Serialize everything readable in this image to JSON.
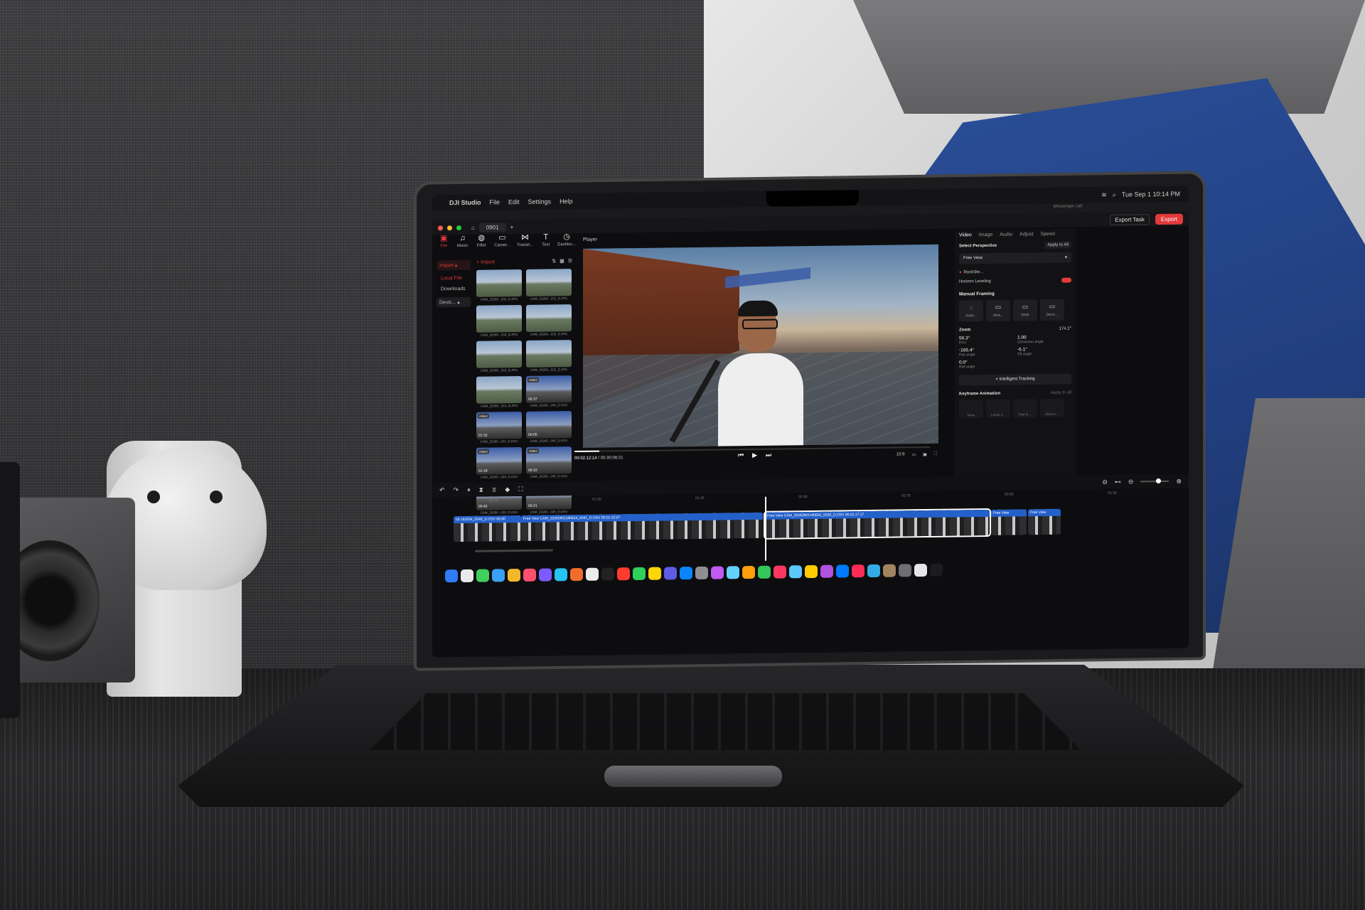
{
  "menubar": {
    "app_name": "DJI Studio",
    "menus": [
      "File",
      "Edit",
      "Settings",
      "Help"
    ],
    "clock": "Tue Sep 1 10:14 PM",
    "messenger": "Messenger call"
  },
  "titlebar": {
    "project_tab": "0901",
    "export_task": "Export Task",
    "export": "Export"
  },
  "left_tools": [
    {
      "icon": "file-icon",
      "glyph": "▣",
      "label": "File",
      "active": true
    },
    {
      "icon": "music-icon",
      "glyph": "♫",
      "label": "Music",
      "active": false
    },
    {
      "icon": "filter-icon",
      "glyph": "◍",
      "label": "Filter",
      "active": false
    },
    {
      "icon": "camera-icon",
      "glyph": "▭",
      "label": "Camer...",
      "active": false
    },
    {
      "icon": "transition-icon",
      "glyph": "⋈",
      "label": "Transit...",
      "active": false
    },
    {
      "icon": "text-icon",
      "glyph": "T",
      "label": "Text",
      "active": false
    },
    {
      "icon": "dashboard-icon",
      "glyph": "◷",
      "label": "Dashbo...",
      "active": false
    }
  ],
  "sidebar": {
    "import_label": "Import",
    "items": [
      "Local File",
      "Downloads"
    ],
    "device_label": "Devic..."
  },
  "media": {
    "import_button": "+ Import",
    "thumbs": [
      {
        "caption": "CAM_20260...032_D.JPG",
        "added": "",
        "duration": "",
        "video": false
      },
      {
        "caption": "CAM_20260...031_D.JPG",
        "added": "",
        "duration": "",
        "video": false
      },
      {
        "caption": "CAM_20260...034_D.JPG",
        "added": "",
        "duration": "",
        "video": false
      },
      {
        "caption": "CAM_20260...033_D.JPG",
        "added": "",
        "duration": "",
        "video": false
      },
      {
        "caption": "CAM_20260...022_D.JPG",
        "added": "",
        "duration": "",
        "video": false
      },
      {
        "caption": "CAM_20260...021_D.JPG",
        "added": "",
        "duration": "",
        "video": false
      },
      {
        "caption": "CAM_20260...014_D.JPG",
        "added": "",
        "duration": "",
        "video": false
      },
      {
        "caption": "CAM_20260...046_D.OSV",
        "added": "Added",
        "duration": "00:37",
        "video": true
      },
      {
        "caption": "CAM_20260...041_D.OSV",
        "added": "Added",
        "duration": "01:32",
        "video": true
      },
      {
        "caption": "CAM_20260...040_D.OSV",
        "added": "",
        "duration": "00:05",
        "video": true
      },
      {
        "caption": "CAM_20260...039_D.OSV",
        "added": "Added",
        "duration": "01:18",
        "video": true
      },
      {
        "caption": "CAM_20260...045_D.OSV",
        "added": "Added",
        "duration": "00:10",
        "video": true
      },
      {
        "caption": "CAM_20260...038_D.OSV",
        "added": "Added",
        "duration": "00:42",
        "video": true
      },
      {
        "caption": "CAM_20260...036_D.OSV",
        "added": "Added",
        "duration": "00:21",
        "video": true
      }
    ]
  },
  "player": {
    "label": "Player",
    "current_time": "00:02:12:14",
    "total_time": "/ 00:30:08:21",
    "aspect": "16:9",
    "progress": 0.07
  },
  "props": {
    "tabs": [
      "Video",
      "Image",
      "Audio",
      "Adjust",
      "Speed"
    ],
    "active_tab": "Video",
    "perspective_title": "Select Perspective",
    "apply_all": "Apply to All",
    "perspective_value": "Free View",
    "rocksteady": "RockSte...",
    "horizon": "Horizon Leveling",
    "manual_framing": "Manual Framing",
    "lenses": [
      {
        "label": "Aster...",
        "icon": "asteroid-icon",
        "glyph": "◌"
      },
      {
        "label": "Ultra...",
        "icon": "ultra-icon",
        "glyph": "▭"
      },
      {
        "label": "Wide",
        "icon": "wide-icon",
        "glyph": "▭"
      },
      {
        "label": "Devic...",
        "icon": "device-icon",
        "glyph": "▭"
      }
    ],
    "zoom_title": "Zoom",
    "zoom_value": "174.2°",
    "params": [
      {
        "value": "56.3°",
        "label": "FOV"
      },
      {
        "value": "1.00",
        "label": "Correction angle"
      },
      {
        "value": "-165.4°",
        "label": "Pan angle"
      },
      {
        "value": "-6.1°",
        "label": "Tilt angle"
      },
      {
        "value": "0.0°",
        "label": "Roll angle"
      }
    ],
    "tracking": "Intelligent Tracking",
    "keyframe_title": "Keyframe Animation",
    "keyframe_apply": "Apply to all",
    "keyframes": [
      "None",
      "Linear s...",
      "Fast In ...",
      "Slow In ..."
    ]
  },
  "timeline": {
    "ruler": [
      "00:30",
      "01:00",
      "01:30",
      "02:00",
      "02:30",
      "03:00",
      "03:30"
    ],
    "clips": [
      {
        "label": "00:162504_0048_D.OSV 00:00",
        "selected": false
      },
      {
        "label": "Free View   CAM_20260901180624_0041_D.OSV  00:01:32:07",
        "selected": false
      },
      {
        "label": "Free View   CAM_20260901180602_0039_D.OSV  00:01:17:17",
        "selected": true
      },
      {
        "label": "Free View",
        "selected": false
      },
      {
        "label": "Free View",
        "selected": false
      }
    ]
  },
  "colors": {
    "accent": "#e23a3a",
    "clip_blue": "#2460c9"
  }
}
